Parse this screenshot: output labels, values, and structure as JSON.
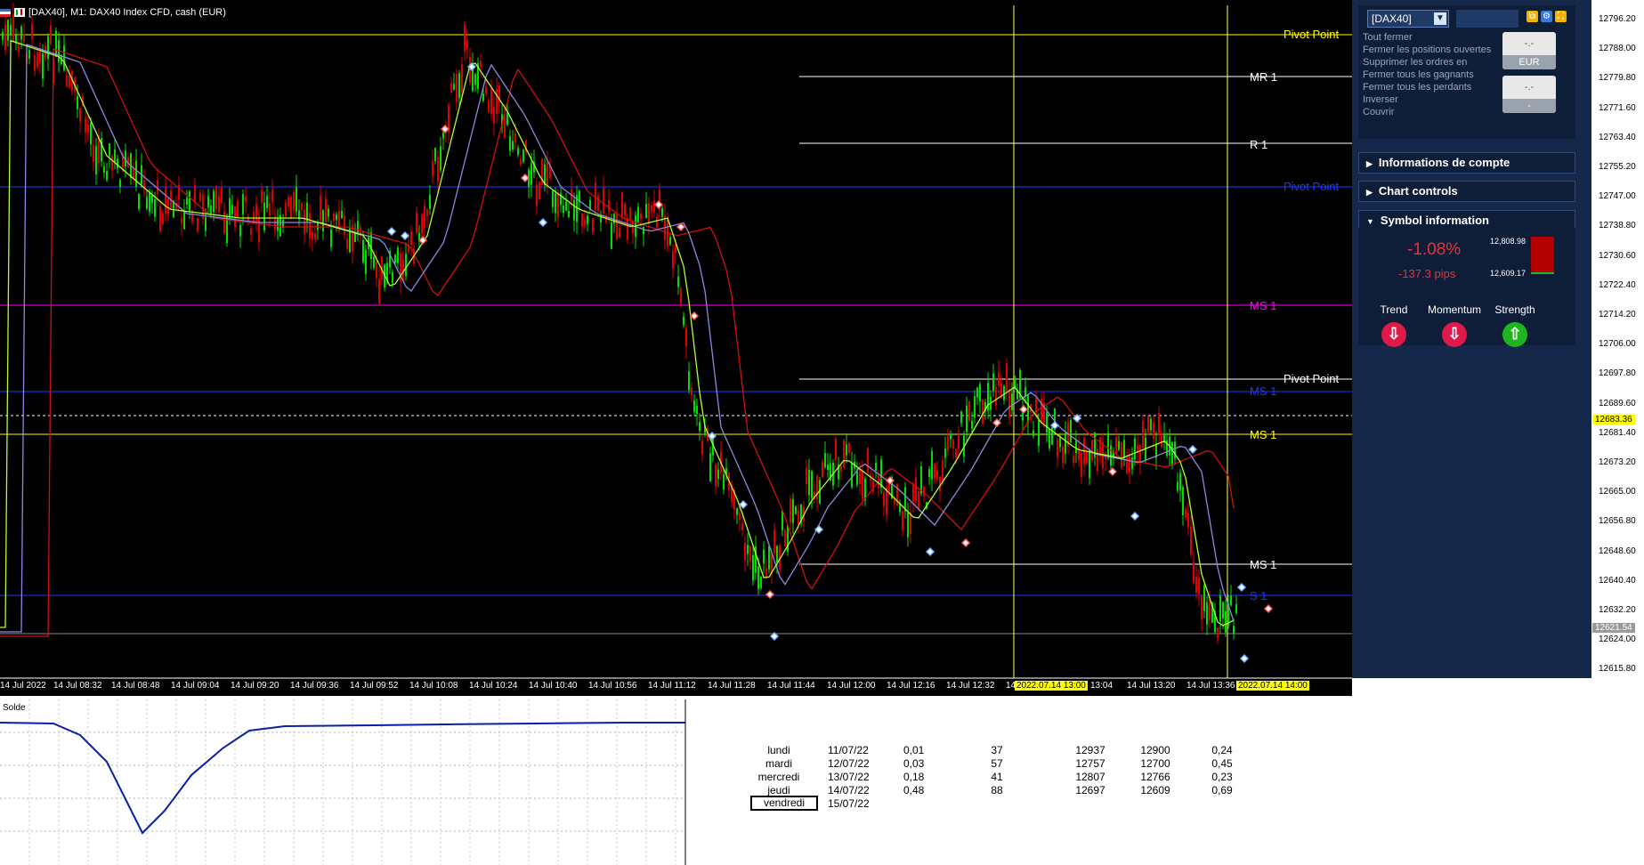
{
  "window": {
    "title": "[DAX40], M1:  DAX40 Index CFD, cash (EUR)"
  },
  "levels": [
    {
      "label": "Pivot Point",
      "color": "#ffff00"
    },
    {
      "label": "MR 1",
      "color": "#ffffff"
    },
    {
      "label": "R 1",
      "color": "#ffffff"
    },
    {
      "label": "Pivot Point",
      "color": "#1a3cff"
    },
    {
      "label": "MS 1",
      "color": "#ff00ff"
    },
    {
      "label": "Pivot Point",
      "color": "#ffffff"
    },
    {
      "label": "MS 1",
      "color": "#1a3cff"
    },
    {
      "label": "MS 1",
      "color": "#ffff00"
    },
    {
      "label": "MS 1",
      "color": "#ffffff"
    },
    {
      "label": "S 1",
      "color": "#1a3cff"
    }
  ],
  "price_axis": {
    "ticks": [
      "12796.20",
      "12788.00",
      "12779.80",
      "12771.60",
      "12763.40",
      "12755.20",
      "12747.00",
      "12738.80",
      "12730.60",
      "12722.40",
      "12714.20",
      "12706.00",
      "12697.80",
      "12689.60",
      "12681.40",
      "12673.20",
      "12665.00",
      "12656.80",
      "12648.60",
      "12640.40",
      "12632.20",
      "12624.00",
      "12615.80"
    ],
    "bid_marker": "12683.36",
    "last_marker": "12621.54"
  },
  "time_axis": {
    "ticks": [
      "14 Jul 2022",
      "14 Jul 08:32",
      "14 Jul 08:48",
      "14 Jul 09:04",
      "14 Jul 09:20",
      "14 Jul 09:36",
      "14 Jul 09:52",
      "14 Jul 10:08",
      "14 Jul 10:24",
      "14 Jul 10:40",
      "14 Jul 10:56",
      "14 Jul 11:12",
      "14 Jul 11:28",
      "14 Jul 11:44",
      "14 Jul 12:00",
      "14 Jul 12:16",
      "14 Jul 12:32",
      "14",
      "13:04",
      "14 Jul 13:20",
      "14 Jul 13:36"
    ],
    "markers": [
      "2022.07.14 13:00",
      "2022.07.14 14:00"
    ]
  },
  "panel": {
    "symbol": "[DAX40]",
    "actions": [
      "Tout fermer",
      "Fermer les positions ouvertes",
      "Supprimer les ordres en",
      "Fermer tous les gagnants",
      "Fermer tous les perdants",
      "Inverser",
      "Couvrir"
    ],
    "buy_button": {
      "value": "-.-",
      "currency": "EUR"
    },
    "sell_button": {
      "value": "-.-",
      "currency": "-"
    },
    "sections": {
      "account": "Informations de compte",
      "chart_controls": "Chart controls",
      "symbol_info": "Symbol information"
    },
    "symbol_info": {
      "change_pct": "-1.08%",
      "change_pips": "-137.3 pips",
      "high": "12,808.98",
      "low": "12,609.17",
      "trend_label": "Trend",
      "momentum_label": "Momentum",
      "strength_label": "Strength",
      "trend_color": "#e0194b",
      "momentum_color": "#e0194b",
      "strength_color": "#1fb51f"
    }
  },
  "balance": {
    "title": "Solde"
  },
  "weekly_table": {
    "rows": [
      {
        "day": "lundi",
        "date": "11/07/22",
        "v1": "0,01",
        "v2": "37",
        "high": "12937",
        "low": "12900",
        "ratio": "0,24"
      },
      {
        "day": "mardi",
        "date": "12/07/22",
        "v1": "0,03",
        "v2": "57",
        "high": "12757",
        "low": "12700",
        "ratio": "0,45"
      },
      {
        "day": "mercredi",
        "date": "13/07/22",
        "v1": "0,18",
        "v2": "41",
        "high": "12807",
        "low": "12766",
        "ratio": "0,23"
      },
      {
        "day": "jeudi",
        "date": "14/07/22",
        "v1": "0,48",
        "v2": "88",
        "high": "12697",
        "low": "12609",
        "ratio": "0,69"
      },
      {
        "day": "vendredi",
        "date": "15/07/22",
        "v1": "",
        "v2": "",
        "high": "",
        "low": "",
        "ratio": ""
      }
    ]
  }
}
